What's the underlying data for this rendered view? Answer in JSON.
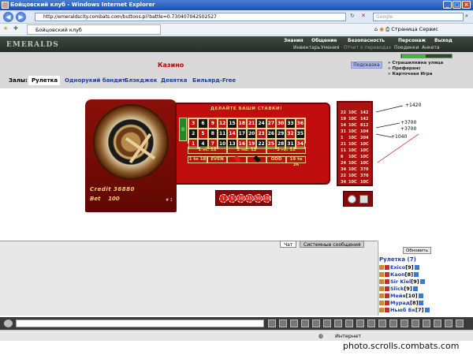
{
  "window": {
    "title": "Бойцовский клуб - Windows Internet Explorer",
    "min": "_",
    "max": "□",
    "close": "×"
  },
  "browser": {
    "url": "http://emeraldscity.combats.com/buttons.pl?battle=0.730407042502527",
    "search_placeholder": "Google",
    "tab_title": "Бойцовский клуб",
    "tools": [
      "Страница",
      "Сервис"
    ]
  },
  "site": {
    "logo": "EMERALDS",
    "menu_top": [
      "Знания",
      "Общение",
      "Безопасность",
      "Персонаж",
      "Выход"
    ],
    "menu_bottom": [
      "Инвентарь",
      "Умения",
      "Отчет о переводах",
      "Поединки",
      "Анкета"
    ]
  },
  "casino": {
    "title": "Казино",
    "help": "Подсказка",
    "links": [
      "Страшилкина улица",
      "Преферанс",
      "Карточная Игра"
    ],
    "halls_label": "Залы:",
    "halls": [
      "Рулетка",
      "Однорукий бандит",
      "Блэкджек",
      "Девятка",
      "Бильярд-Free"
    ],
    "active_hall": "Рулетка"
  },
  "roulette": {
    "bets_header": "ДЕЛАЙТЕ ВАШИ СТАВКИ!",
    "zero": "0",
    "grid": [
      [
        "3",
        "6",
        "9",
        "12",
        "15",
        "18",
        "21",
        "24",
        "27",
        "30",
        "33",
        "36"
      ],
      [
        "2",
        "5",
        "8",
        "11",
        "14",
        "17",
        "20",
        "23",
        "26",
        "29",
        "32",
        "35"
      ],
      [
        "1",
        "4",
        "7",
        "10",
        "13",
        "16",
        "19",
        "22",
        "25",
        "28",
        "31",
        "34"
      ]
    ],
    "grid_colors": [
      [
        "r",
        "b",
        "r",
        "r",
        "b",
        "r",
        "r",
        "b",
        "r",
        "r",
        "b",
        "r"
      ],
      [
        "b",
        "r",
        "b",
        "b",
        "r",
        "b",
        "b",
        "r",
        "b",
        "b",
        "r",
        "b"
      ],
      [
        "r",
        "b",
        "r",
        "b",
        "b",
        "r",
        "r",
        "b",
        "r",
        "b",
        "b",
        "r"
      ]
    ],
    "dozens": [
      "1 st. 12",
      "2 nd. 12",
      "3 rd. 12"
    ],
    "outside": [
      "1 to 18",
      "EVEN",
      "",
      "",
      "ODD",
      "19 to 36"
    ],
    "credit_label": "Credit",
    "credit": "36880",
    "bet_label": "Bet",
    "bet": "100",
    "wheel_note": "# 1",
    "chips": [
      "1",
      "5",
      "10",
      "25",
      "50",
      "100"
    ],
    "history": [
      [
        "22",
        "10C",
        "142"
      ],
      [
        "19",
        "10C",
        "142"
      ],
      [
        "14",
        "10C",
        "812"
      ],
      [
        "31",
        "10C",
        "104"
      ],
      [
        "1",
        "10C",
        "204"
      ],
      [
        "21",
        "10C",
        "10C"
      ],
      [
        "11",
        "10C",
        "10C"
      ],
      [
        "6",
        "10C",
        "10C"
      ],
      [
        "24",
        "10C",
        "10C"
      ],
      [
        "34",
        "10C",
        "370"
      ],
      [
        "22",
        "10C",
        "370"
      ],
      [
        "34",
        "10C",
        "10C"
      ]
    ],
    "annotations": [
      "+1420",
      "+3700",
      "+3700",
      "+1040"
    ]
  },
  "chat": {
    "tabs": [
      "Чат",
      "Системные сообщения"
    ],
    "refresh": "Обновить",
    "room": "Рулетка (7)",
    "users": [
      {
        "name": "Exico",
        "level": "[9]"
      },
      {
        "name": "Каоп",
        "level": "[8]"
      },
      {
        "name": "Sir Kiel",
        "level": "[9]"
      },
      {
        "name": "Slick",
        "level": "[9]"
      },
      {
        "name": "Мейя",
        "level": "[10]"
      },
      {
        "name": "Мурад",
        "level": "[8]"
      },
      {
        "name": "Ньюб Бк",
        "level": "[7]"
      }
    ]
  },
  "status": {
    "zone": "Интернет"
  },
  "watermark": "photo.scrolls.combats.com"
}
